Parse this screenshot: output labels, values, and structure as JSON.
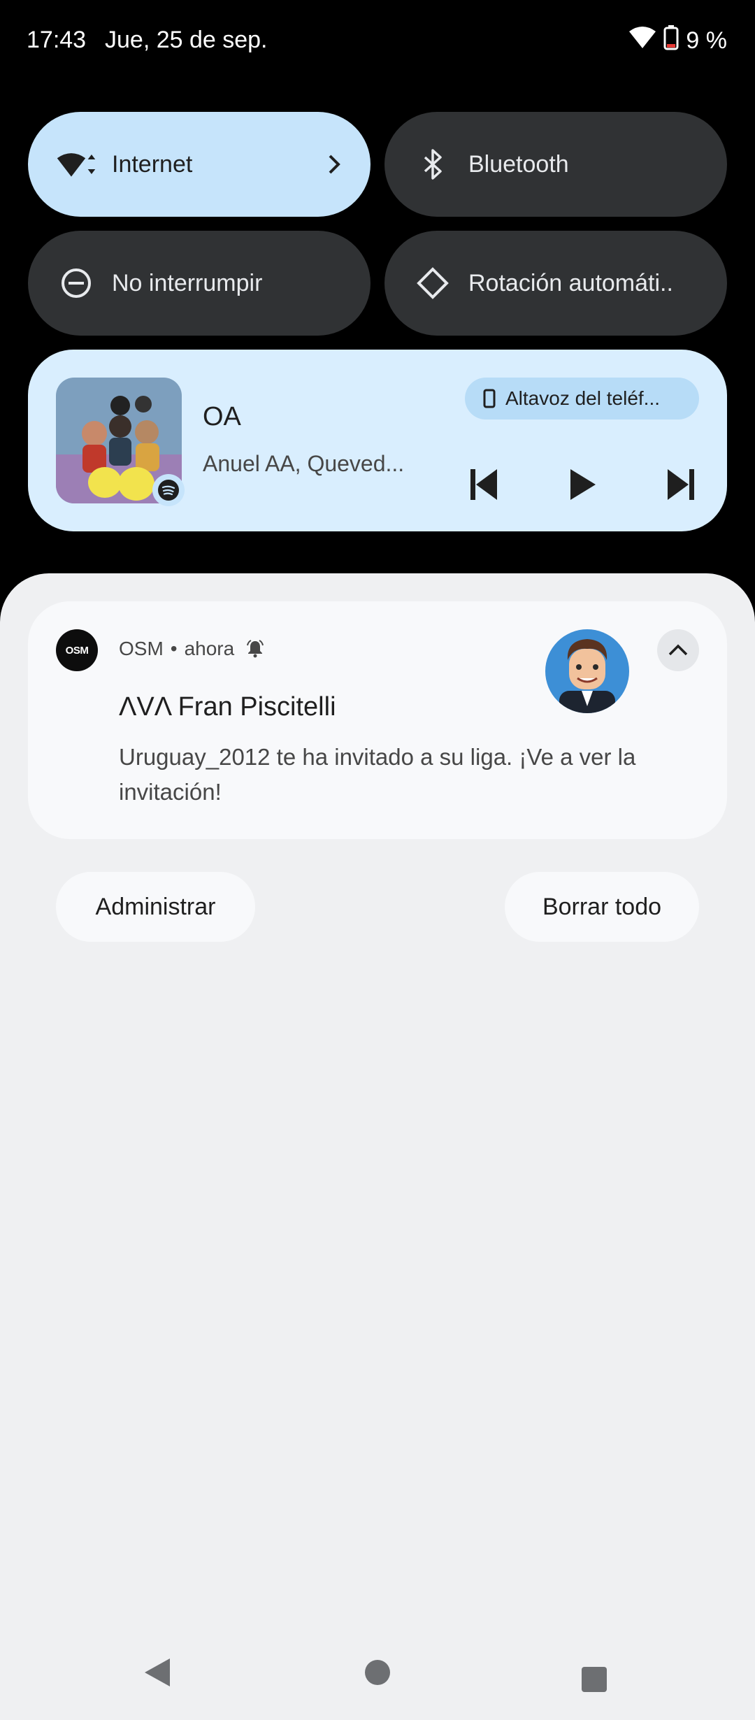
{
  "status_bar": {
    "time": "17:43",
    "date": "Jue, 25 de sep.",
    "battery": "9 %",
    "icons": [
      "wifi-icon",
      "battery-icon"
    ]
  },
  "quick_settings": {
    "internet": {
      "label": "Internet",
      "icon": "wifi-signal-icon",
      "active": true
    },
    "bluetooth": {
      "label": "Bluetooth",
      "icon": "bluetooth-icon",
      "active": false
    },
    "dnd": {
      "label": "No interrumpir",
      "icon": "do-not-disturb-icon",
      "active": false
    },
    "rotation": {
      "label": "Rotación automáti..",
      "icon": "auto-rotate-icon",
      "active": false
    }
  },
  "media": {
    "title": "OA",
    "artist": "Anuel AA, Queved...",
    "output_device": "Altavoz del teléf...",
    "source_app_icon": "spotify-icon",
    "controls": [
      "previous-icon",
      "play-icon",
      "next-icon"
    ]
  },
  "notification": {
    "app_logo_text": "OSM",
    "app_name": "OSM",
    "separator": "•",
    "time": "ahora",
    "title": "ΛVΛ Fran Piscitelli",
    "body": "Uruguay_2012 te ha invitado a su liga. ¡Ve a ver la invitación!"
  },
  "actions": {
    "manage": "Administrar",
    "clear_all": "Borrar todo"
  },
  "colors": {
    "active_tile": "#c6e4fb",
    "inactive_tile": "#303234",
    "media_card": "#d9eefe",
    "sheet": "#eff0f2",
    "battery_low": "#e53935"
  }
}
